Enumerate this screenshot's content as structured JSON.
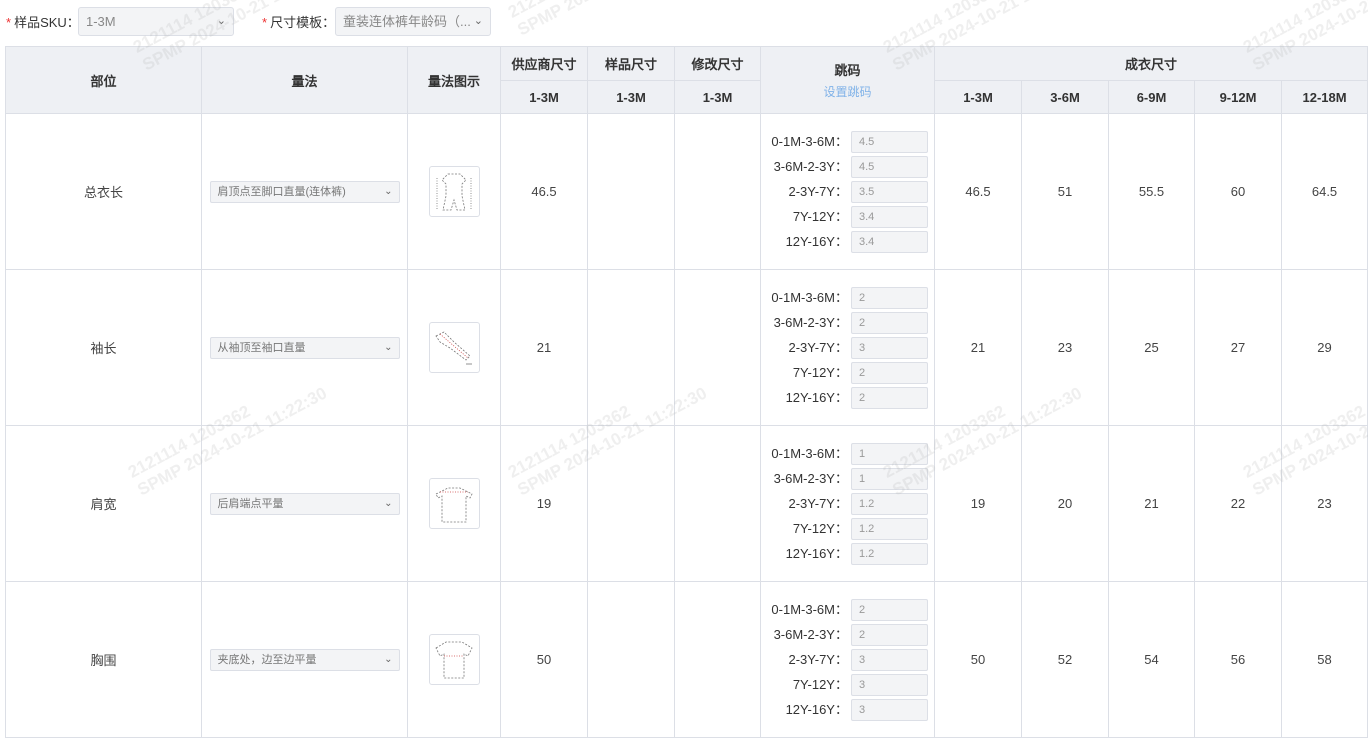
{
  "filters": {
    "sku_label": "样品SKU：",
    "sku_value": "1-3M",
    "template_label": "尺寸模板：",
    "template_value": "童装连体裤年龄码（..."
  },
  "headers": {
    "part": "部位",
    "method": "量法",
    "diagram": "量法图示",
    "supplier": "供应商尺寸",
    "sample": "样品尺寸",
    "modified": "修改尺寸",
    "grading": "跳码",
    "set_grading": "设置跳码",
    "finished": "成衣尺寸",
    "supplier_size": "1-3M",
    "sample_size": "1-3M",
    "modified_size": "1-3M",
    "finished_sizes": [
      "1-3M",
      "3-6M",
      "6-9M",
      "9-12M",
      "12-18M"
    ]
  },
  "rows": [
    {
      "part": "总衣长",
      "method": "肩顶点至脚口直量(连体裤)",
      "diagram_icon": "bodysuit-diagram-icon",
      "supplier": "46.5",
      "sample": "",
      "modified": "",
      "grading": [
        {
          "label": "0-1M-3-6M",
          "value": "4.5"
        },
        {
          "label": "3-6M-2-3Y",
          "value": "4.5"
        },
        {
          "label": "2-3Y-7Y",
          "value": "3.5"
        },
        {
          "label": "7Y-12Y",
          "value": "3.4"
        },
        {
          "label": "12Y-16Y",
          "value": "3.4"
        }
      ],
      "finished": [
        "46.5",
        "51",
        "55.5",
        "60",
        "64.5"
      ]
    },
    {
      "part": "袖长",
      "method": "从袖顶至袖口直量",
      "diagram_icon": "sleeve-diagram-icon",
      "supplier": "21",
      "sample": "",
      "modified": "",
      "grading": [
        {
          "label": "0-1M-3-6M",
          "value": "2"
        },
        {
          "label": "3-6M-2-3Y",
          "value": "2"
        },
        {
          "label": "2-3Y-7Y",
          "value": "3"
        },
        {
          "label": "7Y-12Y",
          "value": "2"
        },
        {
          "label": "12Y-16Y",
          "value": "2"
        }
      ],
      "finished": [
        "21",
        "23",
        "25",
        "27",
        "29"
      ]
    },
    {
      "part": "肩宽",
      "method": "后肩端点平量",
      "diagram_icon": "shoulder-diagram-icon",
      "supplier": "19",
      "sample": "",
      "modified": "",
      "grading": [
        {
          "label": "0-1M-3-6M",
          "value": "1"
        },
        {
          "label": "3-6M-2-3Y",
          "value": "1"
        },
        {
          "label": "2-3Y-7Y",
          "value": "1.2"
        },
        {
          "label": "7Y-12Y",
          "value": "1.2"
        },
        {
          "label": "12Y-16Y",
          "value": "1.2"
        }
      ],
      "finished": [
        "19",
        "20",
        "21",
        "22",
        "23"
      ]
    },
    {
      "part": "胸围",
      "method": "夹底处，边至边平量",
      "diagram_icon": "chest-diagram-icon",
      "supplier": "50",
      "sample": "",
      "modified": "",
      "grading": [
        {
          "label": "0-1M-3-6M",
          "value": "2"
        },
        {
          "label": "3-6M-2-3Y",
          "value": "2"
        },
        {
          "label": "2-3Y-7Y",
          "value": "3"
        },
        {
          "label": "7Y-12Y",
          "value": "3"
        },
        {
          "label": "12Y-16Y",
          "value": "3"
        }
      ],
      "finished": [
        "50",
        "52",
        "54",
        "56",
        "58"
      ]
    }
  ],
  "watermark": {
    "line1": "2121114 1203362",
    "line2": "SPMP 2024-10-21 11:22:30"
  },
  "colors": {
    "required": "#ee3333",
    "header_bg": "#eef0f4",
    "link": "#80b2e8",
    "border": "#dcdfe6",
    "input_bg": "#f3f4f6"
  }
}
